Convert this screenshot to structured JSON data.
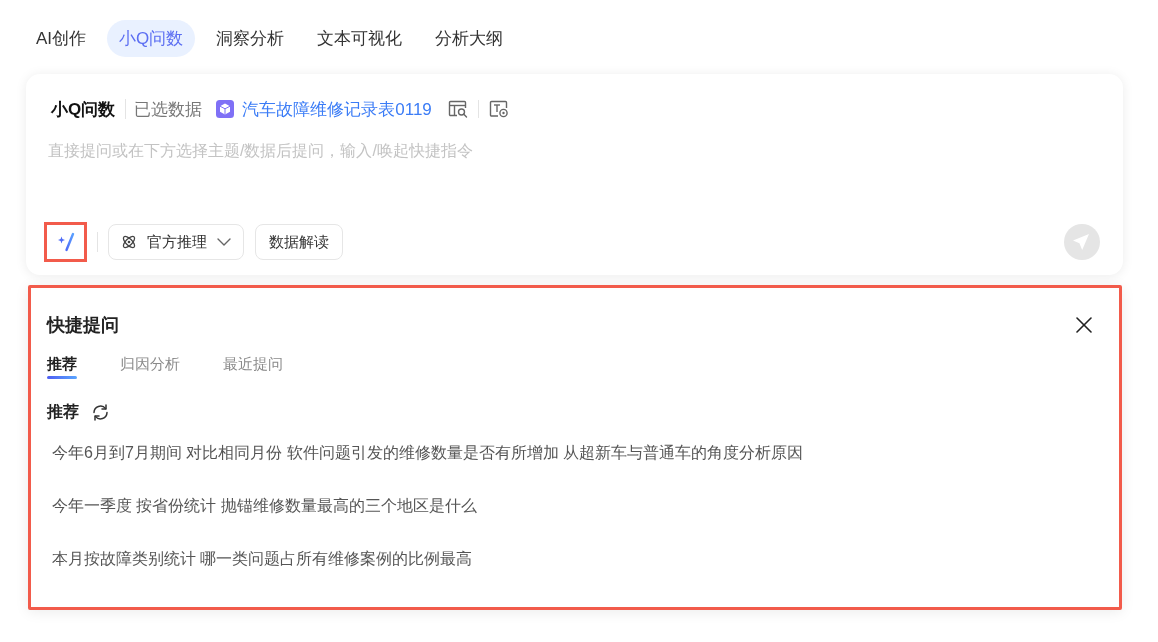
{
  "top_tabs": [
    {
      "label": "AI创作",
      "selected": false
    },
    {
      "label": "小Q问数",
      "selected": true
    },
    {
      "label": "洞察分析",
      "selected": false
    },
    {
      "label": "文本可视化",
      "selected": false
    },
    {
      "label": "分析大纲",
      "selected": false
    }
  ],
  "query_box": {
    "title": "小Q问数",
    "data_label": "已选数据",
    "dataset": "汽车故障维修记录表0119",
    "placeholder": "直接提问或在下方选择主题/数据后提问，输入/唤起快捷指令",
    "quick_command": {
      "highlighted": true
    },
    "mode_dropdown": {
      "label": "官方推理"
    },
    "tool_buttons": [
      "数据解读"
    ],
    "send": {
      "disabled": true
    }
  },
  "quick_panel": {
    "highlighted": true,
    "title": "快捷提问",
    "tabs": [
      {
        "label": "推荐",
        "selected": true
      },
      {
        "label": "归因分析",
        "selected": false
      },
      {
        "label": "最近提问",
        "selected": false
      }
    ],
    "section_title": "推荐",
    "questions": [
      "今年6月到7月期间 对比相同月份 软件问题引发的维修数量是否有所增加 从超新车与普通车的角度分析原因",
      "今年一季度 按省份统计 抛锚维修数量最高的三个地区是什么",
      "本月按故障类别统计 哪一类问题占所有维修案例的比例最高"
    ]
  }
}
